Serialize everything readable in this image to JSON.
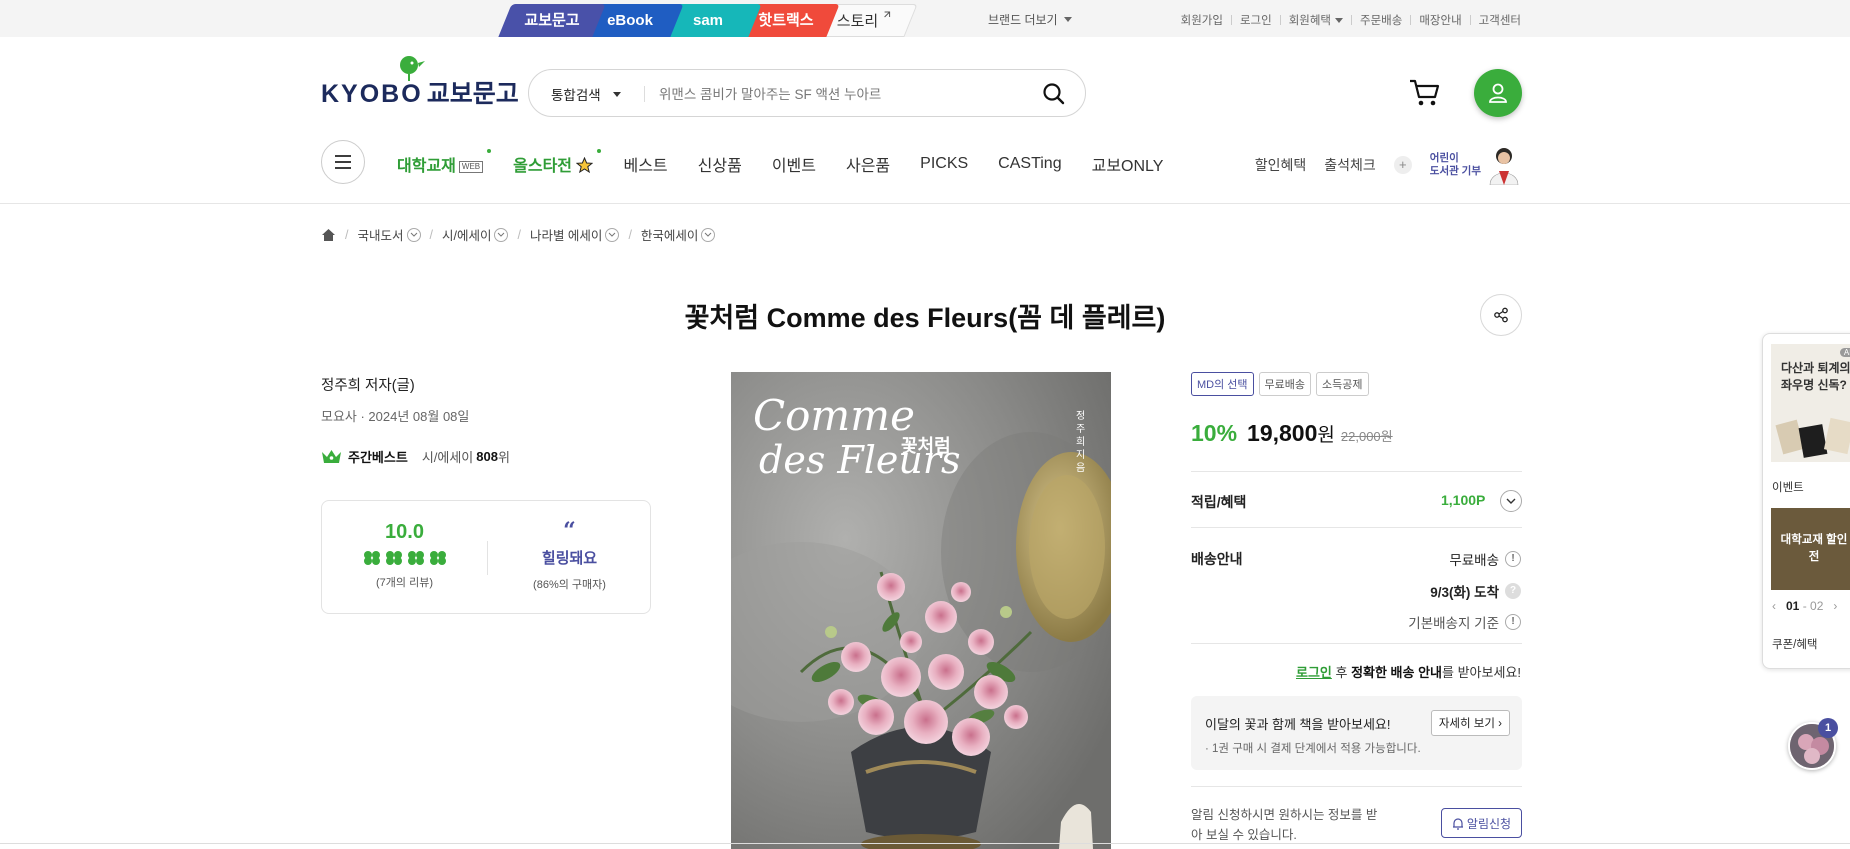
{
  "brand_tabs": [
    "교보문고",
    "eBook",
    "sam",
    "핫트랙스",
    "스토리"
  ],
  "brand_more": "브랜드 더보기",
  "util_links": [
    "회원가입",
    "로그인",
    "회원혜택",
    "주문배송",
    "매장안내",
    "고객센터"
  ],
  "logo": {
    "en": "KYOBO",
    "kr": "교보문고"
  },
  "search": {
    "category": "통합검색",
    "placeholder": "위맨스 콤비가 말아주는 SF 액션 누아르"
  },
  "nav": {
    "items": [
      "대학교재",
      "올스타전",
      "베스트",
      "신상품",
      "이벤트",
      "사은품",
      "PICKS",
      "CASTing",
      "교보ONLY"
    ],
    "badge": "WEB",
    "right": [
      "할인혜택",
      "출석체크"
    ],
    "donate": [
      "어린이",
      "도서관 기부"
    ]
  },
  "breadcrumb": [
    "국내도서",
    "시/에세이",
    "나라별 에세이",
    "한국에세이"
  ],
  "product": {
    "title": "꽃처럼 Comme des Fleurs(꼼 데 플레르)",
    "author": "정주희 저자(글)",
    "publisher_date": "모요사 · 2024년 08월 08일",
    "bestseller": {
      "label": "주간베스트",
      "category": "시/에세이",
      "rank": "808",
      "unit": "위"
    },
    "review": {
      "score": "10.0",
      "count": "(7개의 리뷰)",
      "keyword": "힐링돼요",
      "keyword_pct": "(86%의 구매자)"
    },
    "cover": {
      "title_line1": "Comme",
      "title_line2": "des Fleurs",
      "title_kr": "꽃처럼",
      "author": "정주희 지음"
    }
  },
  "purchase": {
    "tags": [
      "MD의 선택",
      "무료배송",
      "소득공제"
    ],
    "discount": "10%",
    "price": "19,800",
    "won": "원",
    "original_price": "22,000원",
    "benefit_label": "적립/혜택",
    "benefit_value": "1,100P",
    "shipping_label": "배송안내",
    "shipping_free": "무료배송",
    "arrival": "9/3(화) 도착",
    "ship_basis": "기본배송지 기준",
    "login_note": {
      "login": "로그인",
      "mid": " 후 ",
      "bold": "정확한 배송 안내",
      "end": "를 받아보세요!"
    },
    "flower_title": "이달의 꽃과 함께 책을 받아보세요!",
    "flower_sub": "· 1권 구매 시 결제 단계에서 적용 가능합니다.",
    "flower_btn": "자세히 보기",
    "notify_text": "알림 신청하시면 원하시는 정보를 받아 보실 수 있습니다.",
    "notify_btn": "알림신청"
  },
  "float_panel": {
    "ad_text": "다산과 퇴계의 좌우명 신독?",
    "ad_badge": "AD",
    "event_label": "이벤트",
    "event_banner": "대학교재 할인전",
    "pager_current": "01",
    "pager_total": "02",
    "coupon_label": "쿠폰/혜택"
  },
  "chat_badge": "1",
  "colors": {
    "green": "#3aad3c",
    "navy": "#4a4fa0",
    "kyobo": "#4951a9",
    "ebook": "#1f5dc2",
    "sam": "#16b7b9",
    "hot": "#f04a3b"
  }
}
